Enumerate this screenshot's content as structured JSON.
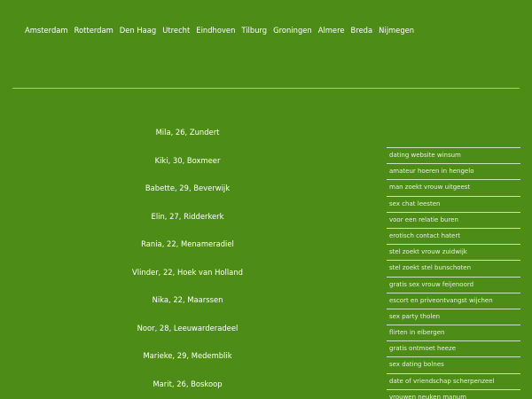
{
  "nav": {
    "cities": [
      "Amsterdam",
      "Rotterdam",
      "Den Haag",
      "Utrecht",
      "Eindhoven",
      "Tilburg",
      "Groningen",
      "Almere",
      "Breda",
      "Nijmegen"
    ]
  },
  "profiles": [
    "Mila, 26, Zundert",
    "Kiki, 30, Boxmeer",
    "Babette, 29, Beverwijk",
    "Elin, 27, Ridderkerk",
    "Rania, 22, Menameradiel",
    "Vlinder, 22, Hoek van Holland",
    "Nika, 22, Maarssen",
    "Noor, 28, Leeuwarderadeel",
    "Marieke, 29, Medemblik",
    "Marit, 26, Boskoop"
  ],
  "sidebar": {
    "links": [
      "dating website winsum",
      "amateur hoeren in hengelo",
      "man zoekt vrouw uitgeest",
      "sex chat leesten",
      "voor een relatie buren",
      "erotisch contact hatert",
      "stel zoekt vrouw zuidwijk",
      "stel zoekt stel bunschoten",
      "gratis sex vrouw feijenoord",
      "escort en priveontvangst wijchen",
      "sex party tholen",
      "flirten in eibergen",
      "gratis ontmoet heeze",
      "sex dating bolnes",
      "date of vriendschap scherpenzeel",
      "vrouwen neuken manum"
    ]
  },
  "colors": {
    "background": "#4e8c18",
    "text": "#ffffff",
    "divider": "#a6c98a"
  }
}
